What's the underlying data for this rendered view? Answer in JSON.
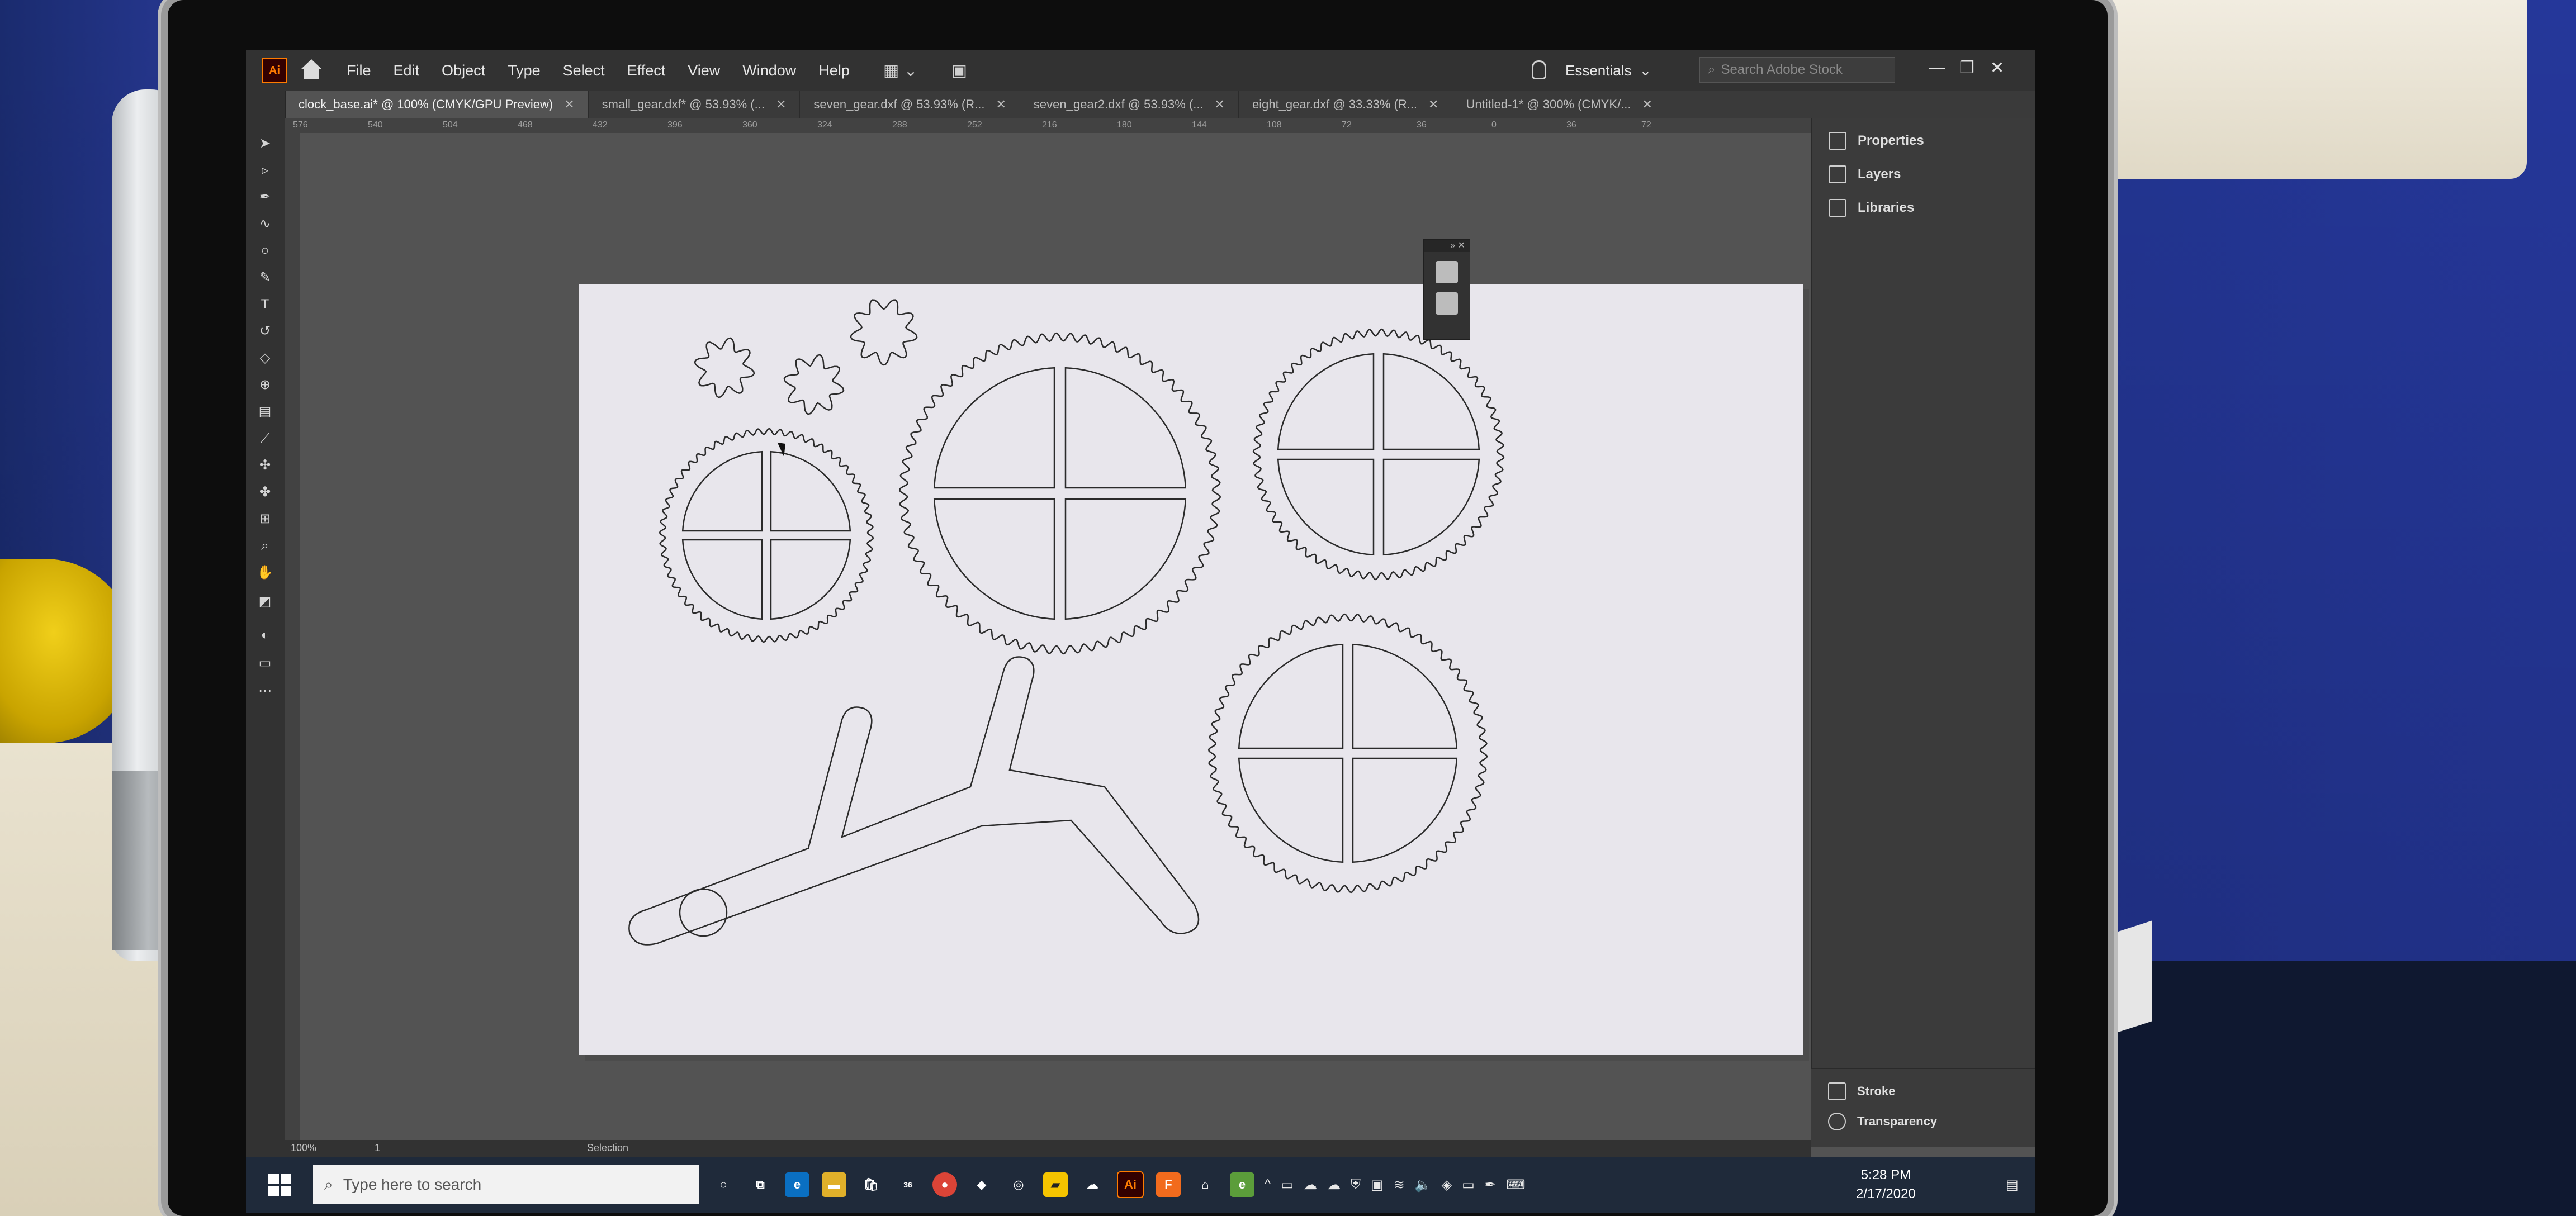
{
  "app": {
    "logo_text": "Ai",
    "menu": [
      "File",
      "Edit",
      "Object",
      "Type",
      "Select",
      "Effect",
      "View",
      "Window",
      "Help"
    ],
    "workspace": "Essentials",
    "search_placeholder": "Search Adobe Stock"
  },
  "tabs": [
    {
      "label": "clock_base.ai* @ 100% (CMYK/GPU Preview)",
      "active": true
    },
    {
      "label": "small_gear.dxf* @ 53.93% (...",
      "active": false
    },
    {
      "label": "seven_gear.dxf @ 53.93% (R...",
      "active": false
    },
    {
      "label": "seven_gear2.dxf @ 53.93% (...",
      "active": false
    },
    {
      "label": "eight_gear.dxf @ 33.33% (R...",
      "active": false
    },
    {
      "label": "Untitled-1* @ 300% (CMYK/...",
      "active": false
    }
  ],
  "ruler_ticks": [
    "576",
    "540",
    "504",
    "468",
    "432",
    "396",
    "360",
    "324",
    "288",
    "252",
    "216",
    "180",
    "144",
    "108",
    "72",
    "36",
    "0",
    "36",
    "72"
  ],
  "panels": {
    "right": [
      "Properties",
      "Layers",
      "Libraries"
    ],
    "bottom": [
      "Stroke",
      "Transparency"
    ]
  },
  "status": {
    "zoom": "100%",
    "artboard": "1",
    "tool": "Selection"
  },
  "taskbar": {
    "search_placeholder": "Type here to search",
    "store_badge": "36",
    "time": "5:28 PM",
    "date": "2/17/2020"
  },
  "icons": {
    "toolbar": [
      "selection-tool-icon",
      "direct-selection-tool-icon",
      "pen-tool-icon",
      "curvature-tool-icon",
      "ellipse-tool-icon",
      "paintbrush-tool-icon",
      "type-tool-icon",
      "rotate-tool-icon",
      "eraser-tool-icon",
      "shape-builder-icon",
      "gradient-tool-icon",
      "eyedropper-tool-icon",
      "blend-tool-icon",
      "symbol-sprayer-icon",
      "artboard-tool-icon",
      "zoom-tool-icon",
      "fill-stroke-icon"
    ]
  }
}
